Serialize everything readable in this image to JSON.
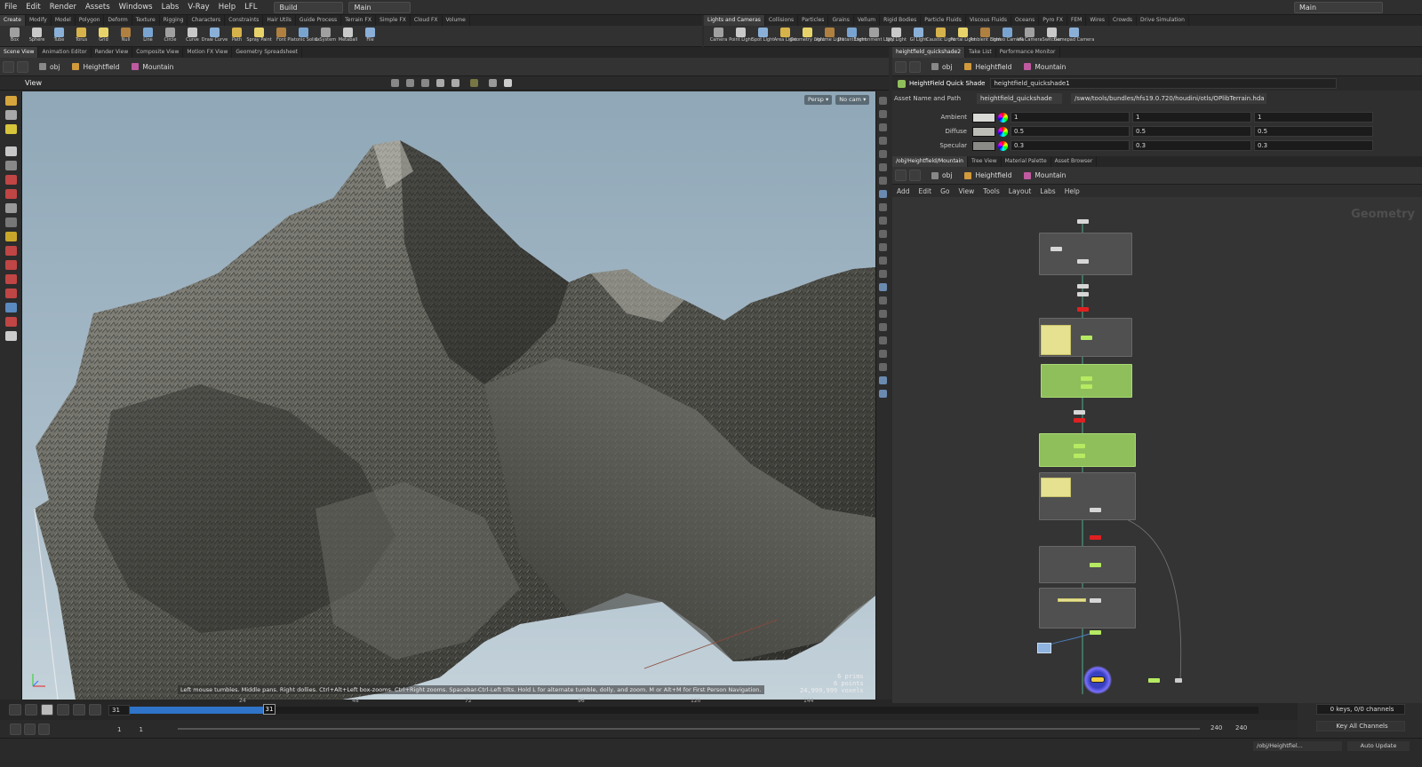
{
  "menu": {
    "items": [
      "File",
      "Edit",
      "Render",
      "Assets",
      "Windows",
      "Labs",
      "V-Ray",
      "Help",
      "LFL"
    ],
    "desktop": "Build",
    "context": "Main",
    "right_desktop": "Main"
  },
  "shelf_left": {
    "tabs": [
      "Create",
      "Modify",
      "Model",
      "Polygon",
      "Deform",
      "Texture",
      "Rigging",
      "Characters",
      "Constraints",
      "Hair Utils",
      "Guide Process",
      "Terrain FX",
      "Simple FX",
      "Cloud FX",
      "Volume"
    ],
    "tools": [
      "Box",
      "Sphere",
      "Tube",
      "Torus",
      "Grid",
      "Null",
      "Line",
      "Circle",
      "Curve",
      "Draw Curve",
      "Path",
      "Spray Paint",
      "Font",
      "Platonic Solids",
      "L-System",
      "Metaball",
      "File"
    ]
  },
  "shelf_right": {
    "tabs": [
      "Lights and Cameras",
      "Collisions",
      "Particles",
      "Grains",
      "Vellum",
      "Rigid Bodies",
      "Particle Fluids",
      "Viscous Fluids",
      "Oceans",
      "Pyro FX",
      "FEM",
      "Wires",
      "Crowds",
      "Drive Simulation"
    ],
    "tools": [
      "Camera",
      "Point Light",
      "Spot Light",
      "Area Light",
      "Geometry Light",
      "Volume Light",
      "Distant Light",
      "Environment Light",
      "Sky Light",
      "GI Light",
      "Caustic Light",
      "Portal Light",
      "Ambient Light",
      "Stereo Camera",
      "VR Camera",
      "Switcher",
      "Gamepad Camera"
    ]
  },
  "left_pane": {
    "tabs": [
      "Scene View",
      "Animation Editor",
      "Render View",
      "Composite View",
      "Motion FX View",
      "Geometry Spreadsheet"
    ],
    "path": [
      "obj",
      "Heightfield",
      "Mountain"
    ]
  },
  "viewport": {
    "title": "View",
    "persp": "Persp ▾",
    "cam": "No cam ▾",
    "hint": "Left mouse tumbles. Middle pans. Right dollies. Ctrl+Alt+Left box-zooms. Ctrl+Right zooms. Spacebar-Ctrl-Left tilts. Hold L for alternate tumble, dolly, and zoom.    M or Alt+M for First Person Navigation.",
    "stats": [
      "6  prims",
      "6  points",
      "24,999,999 voxels"
    ]
  },
  "timeline": {
    "frame": "31",
    "marker": "31",
    "ticks": [
      "24",
      "48",
      "72",
      "96",
      "120",
      "144",
      "168",
      "192",
      "216"
    ],
    "start": "1",
    "start2": "1",
    "end": "240",
    "end2": "240"
  },
  "time_right": {
    "keys": "0 keys, 0/0 channels",
    "key_all": "Key All Channels"
  },
  "right_top": {
    "tabs": [
      "heightfield_quickshade2",
      "Take List",
      "Performance Monitor"
    ],
    "path": [
      "obj",
      "Heightfield",
      "Mountain"
    ]
  },
  "params": {
    "type": "HeightField Quick Shade",
    "name": "heightfield_quickshade1",
    "asset_label": "Asset Name and Path",
    "asset_name": "heightfield_quickshade",
    "asset_path": "/sww/tools/bundles/hfs19.0.720/houdini/otls/OPlibTerrain.hda",
    "rows": [
      {
        "label": "Ambient",
        "swatch": "#d9d9d6",
        "v": [
          "1",
          "1",
          "1"
        ]
      },
      {
        "label": "Diffuse",
        "swatch": "#bdbdb8",
        "v": [
          "0.5",
          "0.5",
          "0.5"
        ]
      },
      {
        "label": "Specular",
        "swatch": "#8a8a86",
        "v": [
          "0.3",
          "0.3",
          "0.3"
        ]
      }
    ]
  },
  "network": {
    "tabs": [
      "/obj/Heightfield/Mountain",
      "Tree View",
      "Material Palette",
      "Asset Browser"
    ],
    "path": [
      "obj",
      "Heightfield",
      "Mountain"
    ],
    "menu": [
      "Add",
      "Edit",
      "Go",
      "View",
      "Tools",
      "Layout",
      "Labs",
      "Help"
    ],
    "watermark": "Geometry"
  },
  "status": {
    "path": "/obj/Heightfiel...",
    "update": "Auto Update"
  },
  "colors": {
    "accent_green": "#8fbf5b",
    "node_red": "#e02020",
    "timebar": "#2f74c8"
  }
}
